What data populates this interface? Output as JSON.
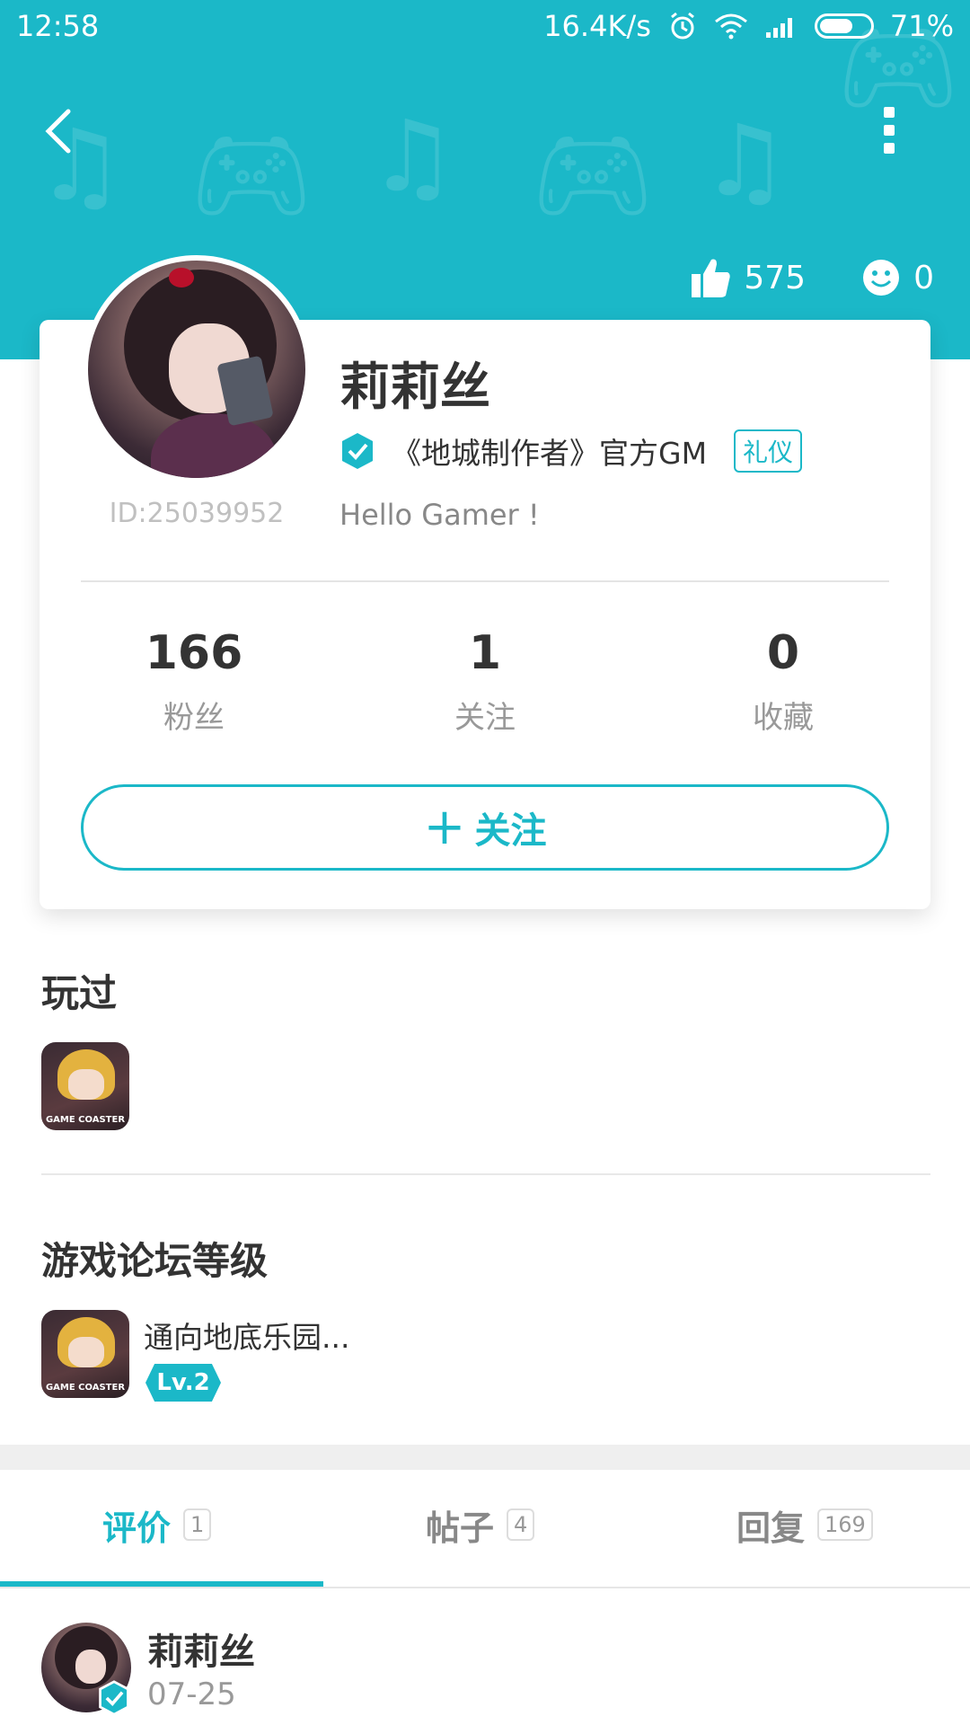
{
  "status_bar": {
    "time": "12:58",
    "speed": "16.4K/s",
    "battery_percent": "71%",
    "battery_level": 0.71
  },
  "header": {
    "likes": "575",
    "smiles": "0"
  },
  "profile": {
    "name": "莉莉丝",
    "id": "ID:25039952",
    "verified_title": "《地城制作者》官方GM",
    "tag": "礼仪",
    "bio": "Hello Gamer !"
  },
  "stats": [
    {
      "value": "166",
      "label": "粉丝"
    },
    {
      "value": "1",
      "label": "关注"
    },
    {
      "value": "0",
      "label": "收藏"
    }
  ],
  "follow_button": {
    "label": "关注"
  },
  "played": {
    "title": "玩过",
    "game_icon_caption": "GAME COASTER"
  },
  "forum_level": {
    "title": "游戏论坛等级",
    "forum_name": "通向地底乐园...",
    "level": "Lv.2",
    "game_icon_caption": "GAME COASTER"
  },
  "tabs": [
    {
      "label": "评价",
      "count": "1"
    },
    {
      "label": "帖子",
      "count": "4"
    },
    {
      "label": "回复",
      "count": "169"
    }
  ],
  "post": {
    "author": "莉莉丝",
    "date": "07-25"
  },
  "colors": {
    "accent": "#1bb8c8",
    "text": "#333333",
    "muted": "#999999"
  }
}
